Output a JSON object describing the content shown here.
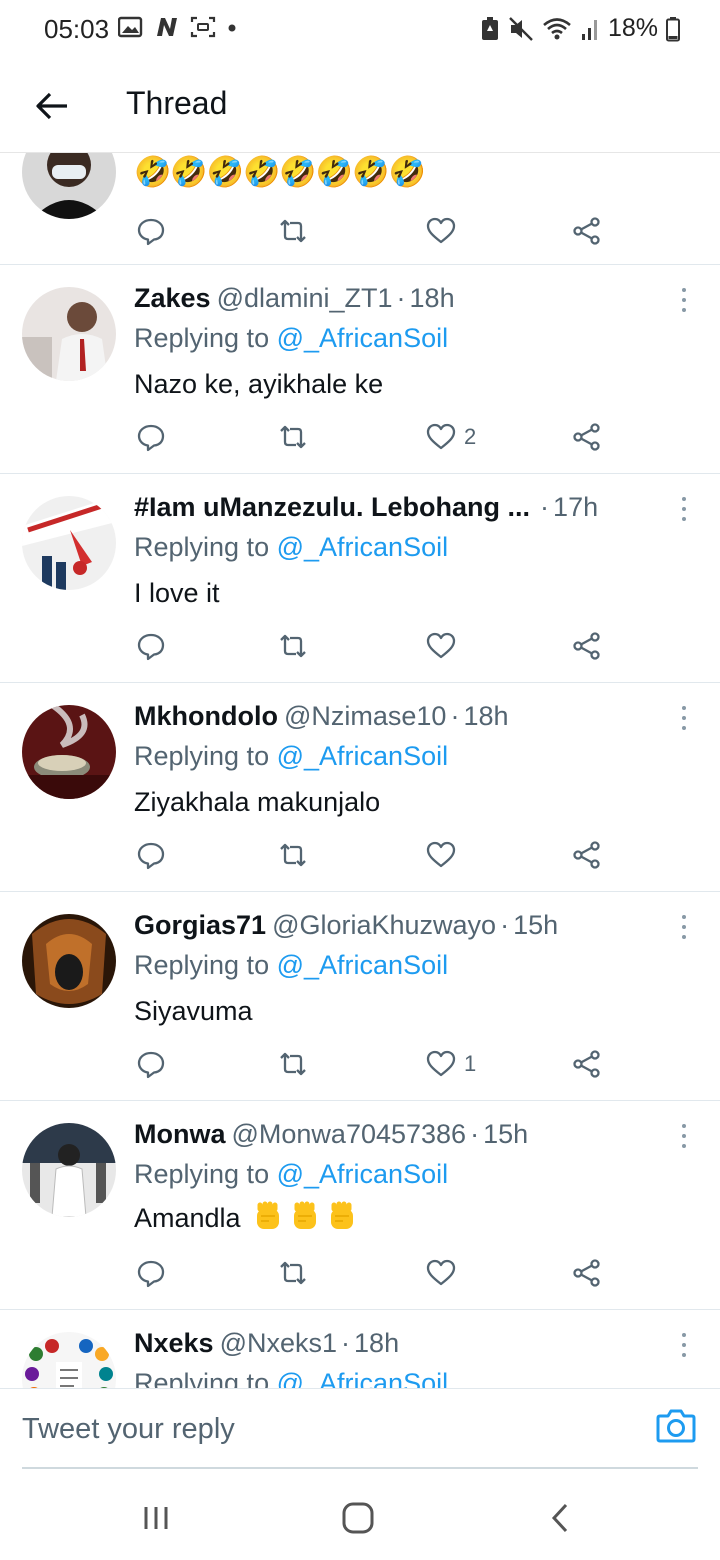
{
  "status_bar": {
    "time": "05:03",
    "battery": "18%",
    "left_icons": [
      "gallery-icon",
      "n-app-icon",
      "screenshot-icon",
      "dot-icon"
    ],
    "right_icons": [
      "battery-saver-icon",
      "mute-icon",
      "wifi-icon",
      "signal-icon",
      "battery-icon"
    ]
  },
  "header": {
    "title": "Thread"
  },
  "top_tweet": {
    "emoji_text": "🤣🤣🤣🤣🤣🤣🤣🤣"
  },
  "replies": [
    {
      "name": "Zakes",
      "handle": "@dlamini_ZT1",
      "separator": "·",
      "time": "18h",
      "replying_prefix": "Replying to",
      "replying_to": "@_AfricanSoil",
      "text": "Nazo ke, ayikhale ke",
      "likes": "2"
    },
    {
      "name": "#Iam uManzezulu. Lebohang ...",
      "handle": "",
      "separator": "·",
      "time": "17h",
      "replying_prefix": "Replying to",
      "replying_to": "@_AfricanSoil",
      "text": "I love it",
      "likes": ""
    },
    {
      "name": "Mkhondolo",
      "handle": "@Nzimase10",
      "separator": "·",
      "time": "18h",
      "replying_prefix": "Replying to",
      "replying_to": "@_AfricanSoil",
      "text": "Ziyakhala makunjalo",
      "likes": ""
    },
    {
      "name": "Gorgias71",
      "handle": "@GloriaKhuzwayo",
      "separator": "·",
      "time": "15h",
      "replying_prefix": "Replying to",
      "replying_to": "@_AfricanSoil",
      "text": "Siyavuma",
      "likes": "1"
    },
    {
      "name": "Monwa",
      "handle": "@Monwa70457386",
      "separator": "·",
      "time": "15h",
      "replying_prefix": "Replying to",
      "replying_to": "@_AfricanSoil",
      "text": "Amandla",
      "likes": ""
    },
    {
      "name": "Nxeks",
      "handle": "@Nxeks1",
      "separator": "·",
      "time": "18h",
      "replying_prefix": "Replying to",
      "replying_to": "@_AfricanSoil",
      "text": "",
      "likes": ""
    }
  ],
  "reply_bar": {
    "placeholder": "Tweet your reply"
  },
  "colors": {
    "accent": "#1d9bf0",
    "secondary_text": "#536471",
    "primary_text": "#0f1419",
    "divider": "#e1e8ed"
  }
}
